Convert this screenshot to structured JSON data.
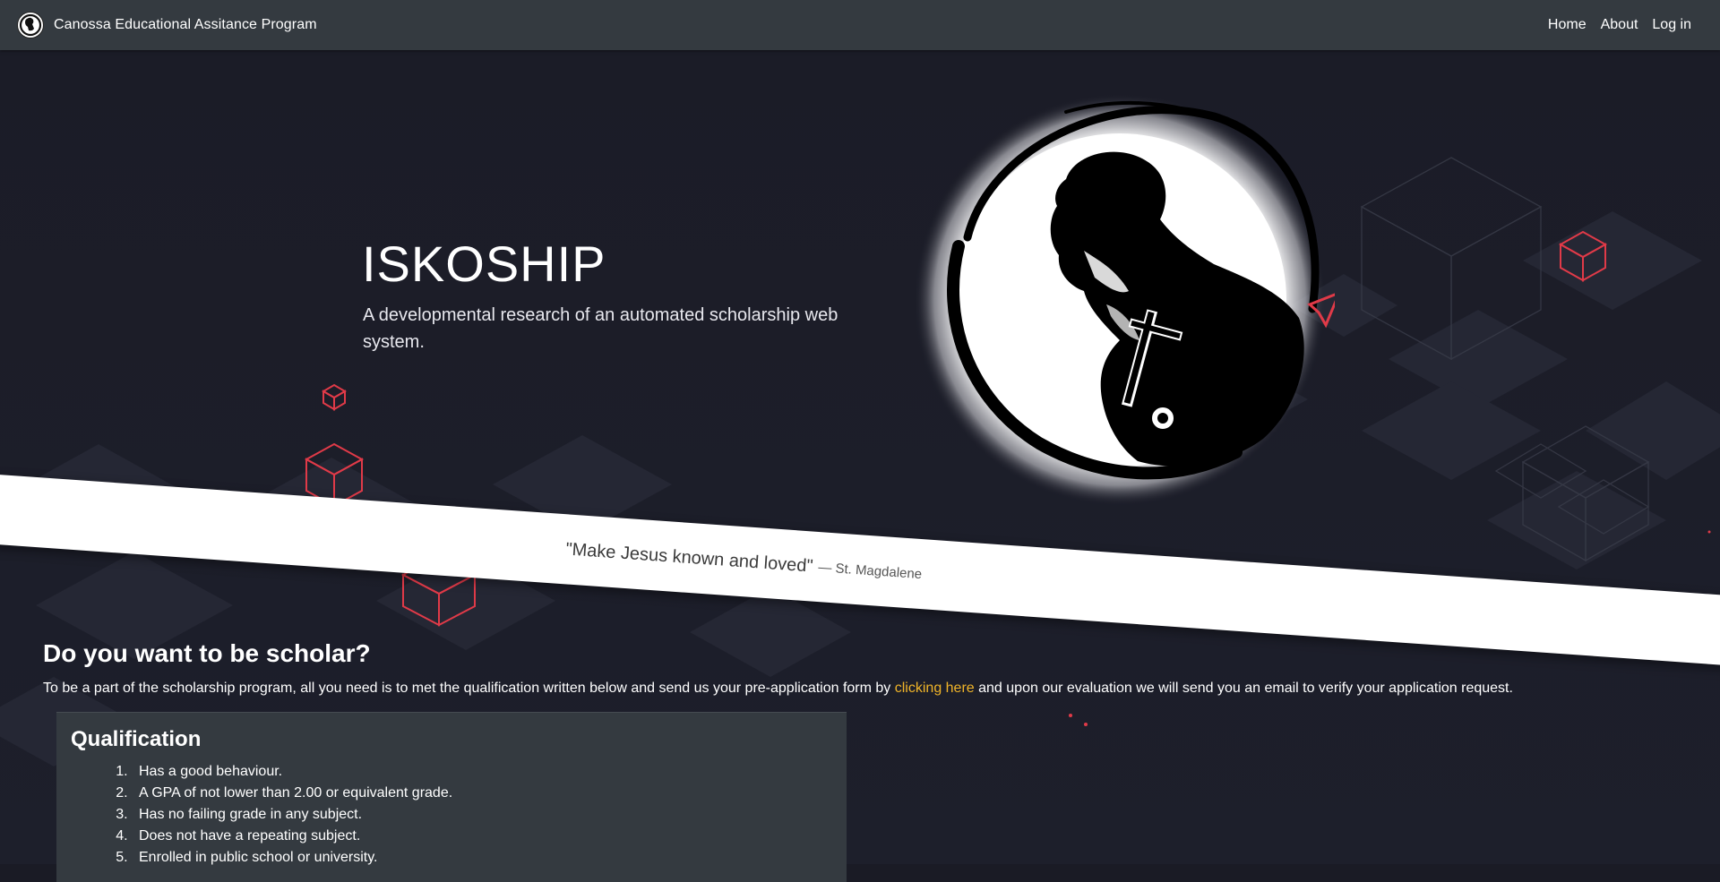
{
  "navbar": {
    "brand_text": "Canossa Educational Assitance Program",
    "brand_icon": "canossa-logo-icon",
    "links": [
      {
        "label": "Home"
      },
      {
        "label": "About"
      },
      {
        "label": "Log in"
      }
    ]
  },
  "hero": {
    "title": "ISKOSHIP",
    "subtitle": "A developmental research of an automated scholarship web system.",
    "emblem_icon": "st-magdalene-emblem-icon"
  },
  "quote": {
    "text": "\"Make Jesus known and loved\"",
    "author": "— St. Magdalene"
  },
  "scholar_section": {
    "heading": "Do you want to be scholar?",
    "text_before": "To be a part of the scholarship program, all you need is to met the qualification written below and send us your pre-application form by ",
    "link_text": "clicking here",
    "text_after": " and upon our evaluation we will send you an email to verify your application request."
  },
  "qualification": {
    "title": "Qualification",
    "items": [
      "Has a good behaviour.",
      "A GPA of not lower than 2.00 or equivalent grade.",
      "Has no failing grade in any subject.",
      "Does not have a repeating subject.",
      "Enrolled in public school or university."
    ]
  },
  "colors": {
    "background": "#1a1b25",
    "navbar": "#343a40",
    "accent_link": "#f0b429",
    "cube_red": "#e03a48",
    "card": "#343a40"
  }
}
